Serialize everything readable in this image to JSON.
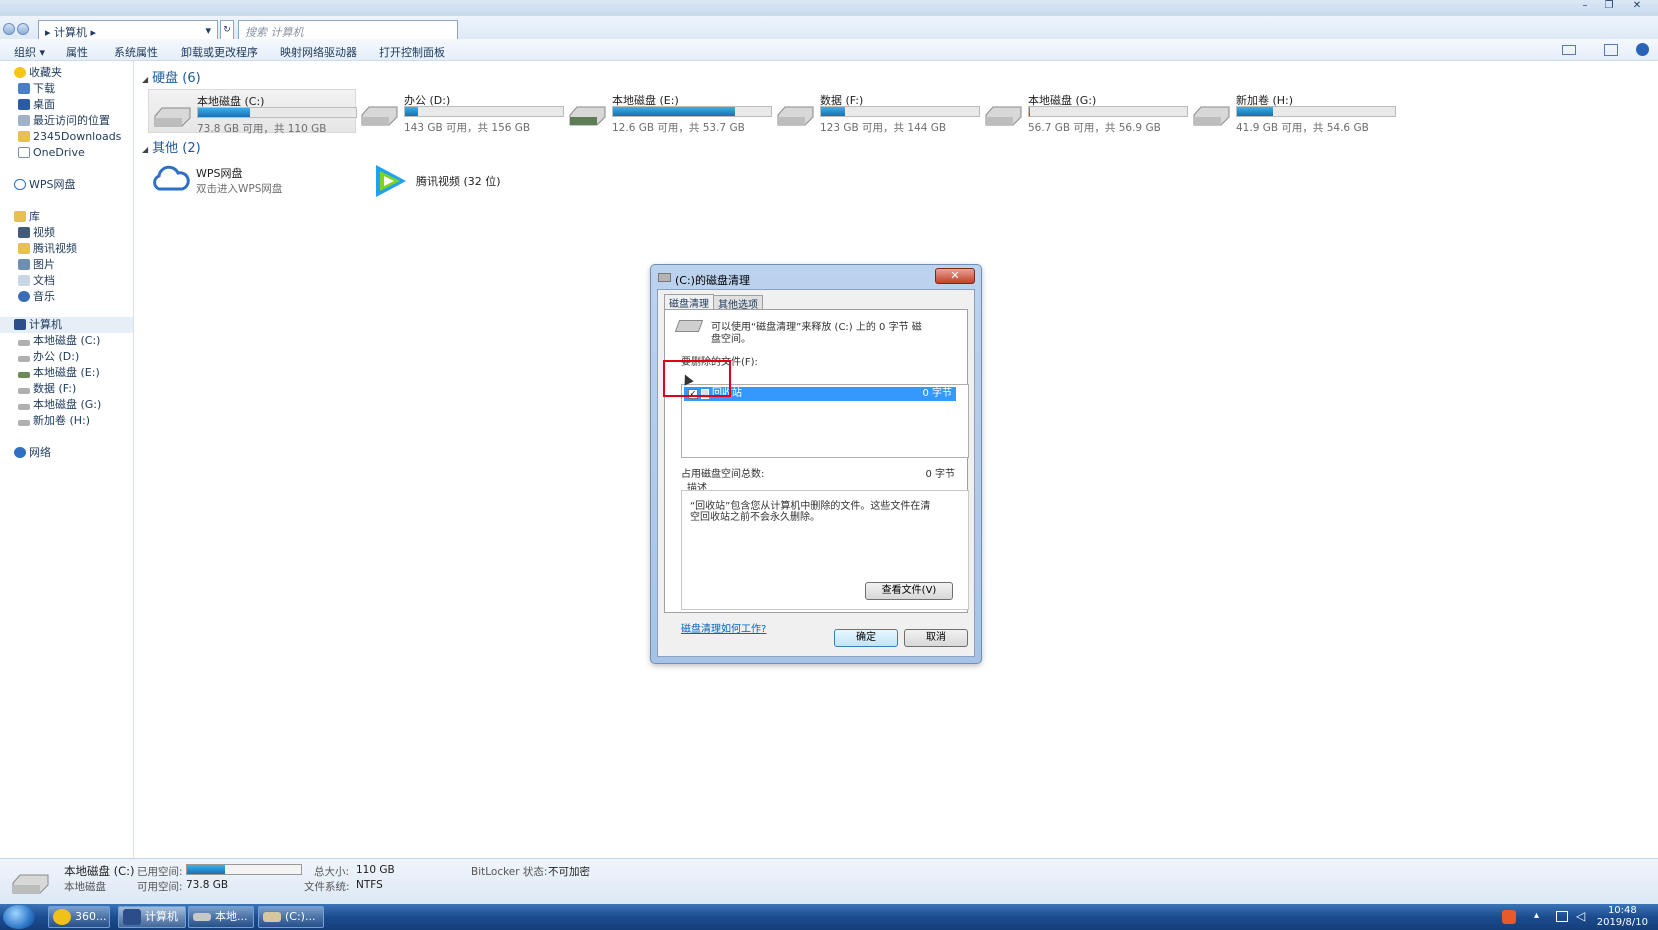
{
  "window": {
    "minimize": "–",
    "restore": "❐",
    "close": "✕"
  },
  "address": {
    "path": "▸ 计算机 ▸",
    "dropdown": "▾",
    "refresh": "↻",
    "search_placeholder": "搜索 计算机"
  },
  "toolbar": {
    "organize": "组织 ▾",
    "properties": "属性",
    "system_properties": "系统属性",
    "uninstall": "卸载或更改程序",
    "map_drive": "映射网络驱动器",
    "control_panel": "打开控制面板"
  },
  "nav": {
    "favorites": "收藏夹",
    "downloads": "下载",
    "desktop": "桌面",
    "recent": "最近访问的位置",
    "d2345": "2345Downloads",
    "onedrive": "OneDrive",
    "wps": "WPS网盘",
    "library": "库",
    "videos": "视频",
    "tencent": "腾讯视频",
    "pictures": "图片",
    "documents": "文档",
    "music": "音乐",
    "computer": "计算机",
    "drives": [
      "本地磁盘 (C:)",
      "办公 (D:)",
      "本地磁盘 (E:)",
      "数据 (F:)",
      "本地磁盘 (G:)",
      "新加卷 (H:)"
    ],
    "network": "网络"
  },
  "groups": {
    "hard_disks": "硬盘 (6)",
    "other": "其他 (2)"
  },
  "drives": [
    {
      "name": "本地磁盘 (C:)",
      "free": "73.8 GB 可用，共 110 GB",
      "used_fraction": 0.33
    },
    {
      "name": "办公 (D:)",
      "free": "143 GB 可用，共 156 GB",
      "used_fraction": 0.08
    },
    {
      "name": "本地磁盘 (E:)",
      "free": "12.6 GB 可用，共 53.7 GB",
      "used_fraction": 0.77
    },
    {
      "name": "数据 (F:)",
      "free": "123 GB 可用，共 144 GB",
      "used_fraction": 0.15
    },
    {
      "name": "本地磁盘 (G:)",
      "free": "56.7 GB 可用，共 56.9 GB",
      "used_fraction": 0.004
    },
    {
      "name": "新加卷 (H:)",
      "free": "41.9 GB 可用，共 54.6 GB",
      "used_fraction": 0.23
    }
  ],
  "others": [
    {
      "name": "WPS网盘",
      "sub": "双击进入WPS网盘"
    },
    {
      "name": "腾讯视频 (32 位)",
      "sub": ""
    }
  ],
  "dialog": {
    "title": "(C:)的磁盘清理",
    "close": "✕",
    "tab_cleanup": "磁盘清理",
    "tab_more": "其他选项",
    "intro_line1": "可以使用“磁盘清理”来释放 (C:) 上的 0 字节 磁",
    "intro_line2": "盘空间。",
    "files_label": "要删除的文件(F):",
    "item_name": "回收站",
    "item_size": "0 字节",
    "check": "✓",
    "total_label": "占用磁盘空间总数:",
    "total_value": "0 字节",
    "desc_label": "描述",
    "desc_line1": "“回收站”包含您从计算机中删除的文件。这些文件在清",
    "desc_line2": "空回收站之前不会永久删除。",
    "view_files": "查看文件(V)",
    "how_link": "磁盘清理如何工作?",
    "ok": "确定",
    "cancel": "取消"
  },
  "details": {
    "name": "本地磁盘 (C:)",
    "type": "本地磁盘",
    "used_label": "已用空间:",
    "used_fraction": 0.33,
    "total_label": "总大小:",
    "total": "110 GB",
    "free_label": "可用空间:",
    "free": "73.8 GB",
    "fs_label": "文件系统:",
    "fs": "NTFS",
    "bitlocker_label": "BitLocker 状态:",
    "bitlocker": "不可加密"
  },
  "taskbar": {
    "t360": "360...",
    "computer": "计算机",
    "local": "本地...",
    "cdrive": "(C:)...",
    "time": "10:48",
    "date": "2019/8/10"
  },
  "colors": {
    "accent": "#3399ff",
    "bar_fill": "#1a6fb3",
    "highlight_box": "#e0001b"
  }
}
